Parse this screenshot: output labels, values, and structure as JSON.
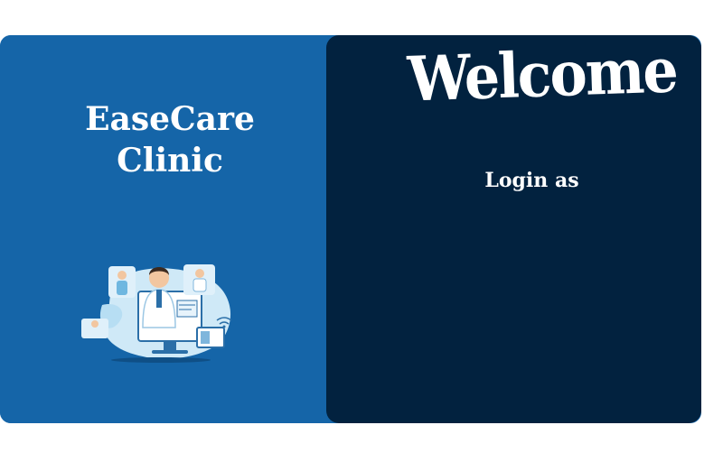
{
  "brand": {
    "line1": "EaseCare",
    "line2": "Clinic"
  },
  "hero": {
    "welcome": "Welcome",
    "login_prompt": "Login as"
  },
  "colors": {
    "left_panel": "#1565a8",
    "right_panel": "#02223f",
    "text": "#ffffff"
  }
}
